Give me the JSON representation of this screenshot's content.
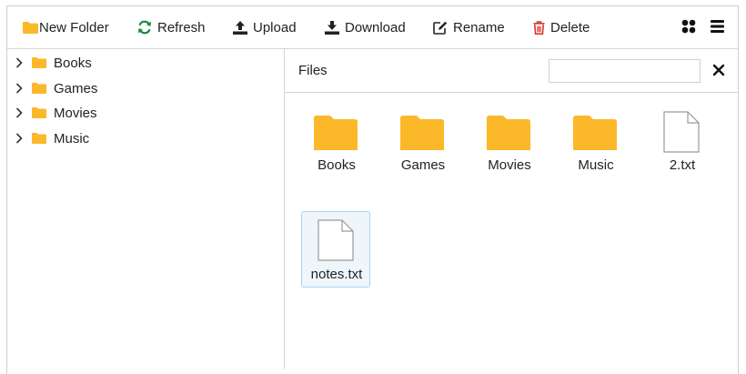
{
  "toolbar": {
    "new_folder": "New Folder",
    "refresh": "Refresh",
    "upload": "Upload",
    "download": "Download",
    "rename": "Rename",
    "delete": "Delete"
  },
  "tree": {
    "items": [
      {
        "label": "Books"
      },
      {
        "label": "Games"
      },
      {
        "label": "Movies"
      },
      {
        "label": "Music"
      }
    ]
  },
  "files_pane": {
    "title": "Files",
    "search_value": "",
    "items": [
      {
        "name": "Books",
        "type": "folder",
        "selected": false
      },
      {
        "name": "Games",
        "type": "folder",
        "selected": false
      },
      {
        "name": "Movies",
        "type": "folder",
        "selected": false
      },
      {
        "name": "Music",
        "type": "folder",
        "selected": false
      },
      {
        "name": "2.txt",
        "type": "file",
        "selected": false
      },
      {
        "name": "notes.txt",
        "type": "file",
        "selected": true
      }
    ]
  },
  "colors": {
    "folder": "#fbb829",
    "refresh": "#1e8a36",
    "delete": "#d9342b",
    "selection_bg": "#eef6fc",
    "selection_border": "#a8d4f1",
    "border": "#cfcfcf"
  }
}
